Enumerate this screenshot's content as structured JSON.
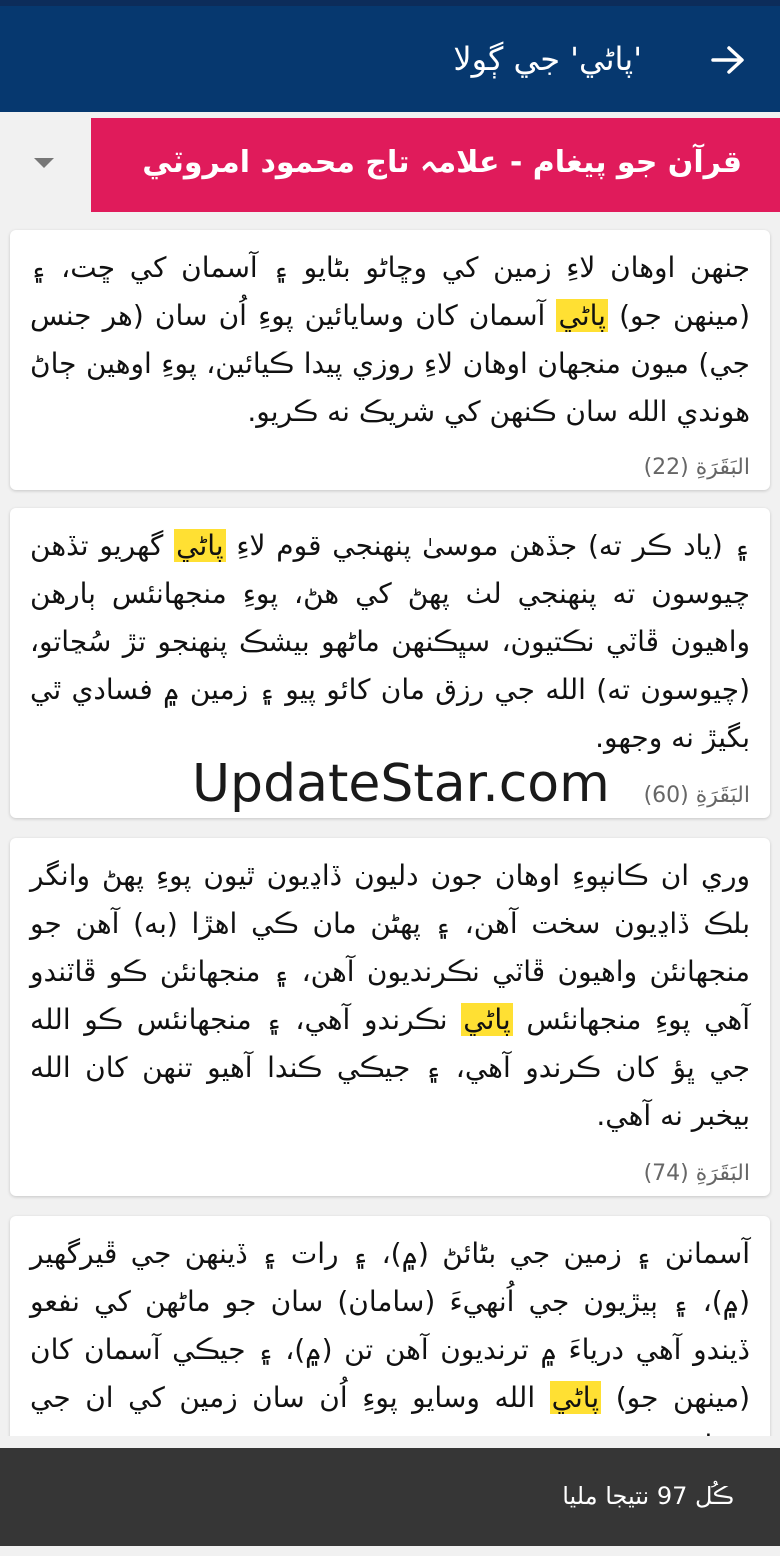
{
  "header": {
    "title": "'پاڻي' جي ڳولا",
    "back_icon": "arrow-right-icon"
  },
  "selector": {
    "label": "قرآن جو پيغام - علامہ تاج محمود امروٽي",
    "dropdown_icon": "triangle-down-icon"
  },
  "highlight_color": "#ffe033",
  "results": [
    {
      "before": "جنھن اوھان لاءِ زمين کي وڇاڻو بڻايو ۽ آسمان کي ڇت، ۽ (مينھن جو) ",
      "highlight": "پاڻي",
      "after": " آسمان کان وسايائين پوءِ اُن سان (ھر جنس جي) ميون منجھان اوھان لاءِ روزي پيدا ڪيائين، پوءِ اوھين ڄاڻ ھوندي الله سان ڪنھن کي شريڪ نه ڪريو.",
      "reference": "البَقَرَةِ (22)"
    },
    {
      "before": "۽ (ياد ڪر ته) جڏھن موسىٰ پنھنجي قوم لاءِ ",
      "highlight": "پاڻي",
      "after": " گھريو تڏھن چيوسون ته پنھنجي لٺ پھڻ کي ھڻ، پوءِ منجھانئس ٻارھن واھيون ڦاٽي نڪتيون، سڀڪنھن ماڻھو بيشڪ پنھنجو تڙ سُڃاتو، (چيوسون ته) الله جي رزق مان کائو پيو ۽ زمين ۾ فسادي ٿي بگيڙ نه وجھو.",
      "reference": "البَقَرَةِ (60)"
    },
    {
      "before": "وري ان ڪانپوءِ اوھان جون دليون ڏاڍيون ٿيون پوءِ پھڻ وانگر بلڪ ڏاڍيون سخت آھن، ۽ پھڻن مان ڪي اھڙا (به) آھن جو منجھانئن واھيون ڦاٽي نڪرنديون آھن، ۽ منجھانئن ڪو ڦاٽندو آھي پوءِ منجھانئس ",
      "highlight": "پاڻي",
      "after": " نڪرندو آھي، ۽ منجھانئس ڪو الله جي ڀؤ کان ڪرندو آھي، ۽ جيڪي ڪندا آھيو تنھن کان الله بيخبر نه آھي.",
      "reference": "البَقَرَةِ (74)"
    },
    {
      "before": "آسمانن ۽ زمين جي بڻائڻ (۾)، ۽ رات ۽ ڏينھن جي ڦيرگھير (۾)، ۽ ٻيڙيون جي اُنھيءَ (سامان) سان جو ماڻھن کي نفعو ڏيندو آھي درياءَ ۾ ترنديون آھن تن (۾)، ۽ جيڪي آسمان کان (مينھن جو) ",
      "highlight": "پاڻي",
      "after": " الله وسايو پوءِ اُن سان زمين کي ان جي وسامڻ",
      "reference": ""
    }
  ],
  "watermark": "UpdateStar.com",
  "footer": {
    "count_text": "ڪُل 97 نتيجا مليا"
  }
}
